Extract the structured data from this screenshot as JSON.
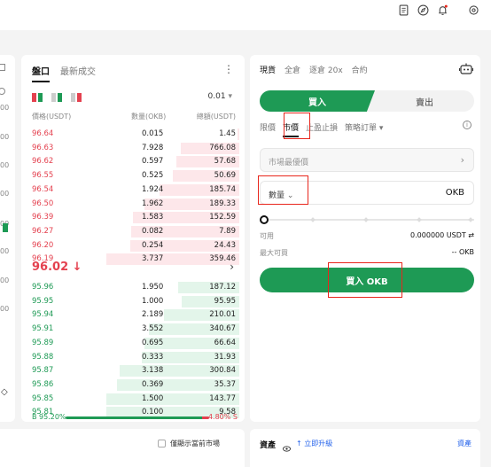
{
  "colors": {
    "buy": "#1e9a55",
    "sell": "#e4414f",
    "highlight": "#e8261c"
  },
  "topbar": {
    "icons": [
      "document-icon",
      "compass-icon",
      "bell-icon",
      "settings-icon"
    ]
  },
  "left_strip": {
    "values": [
      "00",
      "00",
      "00",
      "00",
      "00",
      "00",
      "00",
      "00"
    ]
  },
  "orderbook": {
    "tabs": [
      {
        "label": "盤口",
        "active": true
      },
      {
        "label": "最新成交",
        "active": false
      }
    ],
    "precision": "0.01",
    "headers": {
      "price": "價格(USDT)",
      "amount": "數量(OKB)",
      "total": "總額(USDT)"
    },
    "asks": [
      {
        "price": "96.64",
        "amount": "0.015",
        "total": "1.45",
        "depth": 0.01
      },
      {
        "price": "96.63",
        "amount": "7.928",
        "total": "766.08",
        "depth": 0.44
      },
      {
        "price": "96.62",
        "amount": "0.597",
        "total": "57.68",
        "depth": 0.47
      },
      {
        "price": "96.55",
        "amount": "0.525",
        "total": "50.69",
        "depth": 0.5
      },
      {
        "price": "96.54",
        "amount": "1.924",
        "total": "185.74",
        "depth": 0.6
      },
      {
        "price": "96.50",
        "amount": "1.962",
        "total": "189.33",
        "depth": 0.71
      },
      {
        "price": "96.39",
        "amount": "1.583",
        "total": "152.59",
        "depth": 0.8
      },
      {
        "price": "96.27",
        "amount": "0.082",
        "total": "7.89",
        "depth": 0.81
      },
      {
        "price": "96.20",
        "amount": "0.254",
        "total": "24.43",
        "depth": 0.82
      },
      {
        "price": "96.19",
        "amount": "3.737",
        "total": "359.46",
        "depth": 1.0
      }
    ],
    "last_price": "96.02",
    "last_direction": "↓",
    "bids": [
      {
        "price": "95.96",
        "amount": "1.950",
        "total": "187.12",
        "depth": 0.46
      },
      {
        "price": "95.95",
        "amount": "1.000",
        "total": "95.95",
        "depth": 0.43
      },
      {
        "price": "95.94",
        "amount": "2.189",
        "total": "210.01",
        "depth": 0.57
      },
      {
        "price": "95.91",
        "amount": "3.552",
        "total": "340.67",
        "depth": 0.68
      },
      {
        "price": "95.89",
        "amount": "0.695",
        "total": "66.64",
        "depth": 0.71
      },
      {
        "price": "95.88",
        "amount": "0.333",
        "total": "31.93",
        "depth": 0.73
      },
      {
        "price": "95.87",
        "amount": "3.138",
        "total": "300.84",
        "depth": 0.9
      },
      {
        "price": "95.86",
        "amount": "0.369",
        "total": "35.37",
        "depth": 0.92
      },
      {
        "price": "95.85",
        "amount": "1.500",
        "total": "143.77",
        "depth": 1.0
      },
      {
        "price": "95.81",
        "amount": "0.100",
        "total": "9.58",
        "depth": 1.0
      }
    ],
    "ratio": {
      "buy_label": "B 95.20%",
      "sell_label": "4.80% S",
      "buy_pct": 95.2
    }
  },
  "trade": {
    "tabs": [
      {
        "label": "現貨",
        "active": true
      },
      {
        "label": "全倉",
        "active": false
      },
      {
        "label": "逐倉 20x",
        "active": false
      },
      {
        "label": "合約",
        "active": false
      }
    ],
    "buy_label": "買入",
    "sell_label": "賣出",
    "order_types": [
      {
        "label": "限價",
        "active": false
      },
      {
        "label": "市價",
        "active": true
      },
      {
        "label": "止盈止損",
        "active": false
      },
      {
        "label": "策略訂單 ▾",
        "active": false
      }
    ],
    "market_price_label": "市場最優價",
    "amount_label": "數量",
    "amount_unit": "OKB",
    "slider_value": 0,
    "available_label": "可用",
    "available_value": "0.000000 USDT ⇄",
    "max_buy_label": "最大可買",
    "max_buy_value": "-- OKB",
    "submit_label": "買入 OKB"
  },
  "bottom_left": {
    "only_current_label": "僅顯示當前市場"
  },
  "bottom_right": {
    "title": "資產",
    "upgrade_label": "↑ 立即升級",
    "right_label": "資產"
  }
}
